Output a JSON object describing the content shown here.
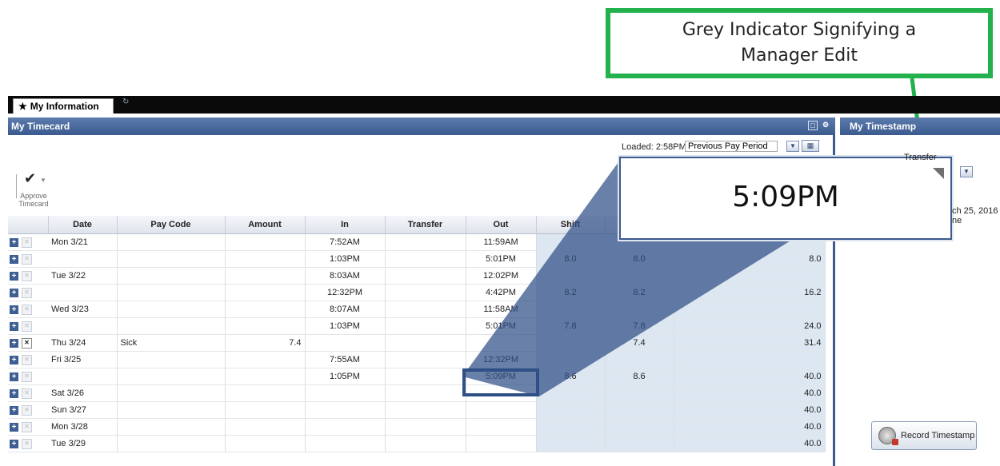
{
  "callout": {
    "line1": "Grey Indicator Signifying a",
    "line2": "Manager Edit"
  },
  "tabs": {
    "active_label": "My Information"
  },
  "left_panel": {
    "title": "My Timecard"
  },
  "right_panel": {
    "title": "My Timestamp",
    "transfer_label": "Transfer",
    "date_line1": "ch 25, 2016",
    "date_line2": "ne",
    "record_button": "Record Timestamp"
  },
  "toolbar": {
    "loaded_text": "Loaded: 2:58PM",
    "period_value": "Previous Pay Period",
    "approve_label_1": "Approve",
    "approve_label_2": "Timecard"
  },
  "zoom": {
    "value": "5:09PM"
  },
  "table": {
    "headers": [
      "Date",
      "Pay Code",
      "Amount",
      "In",
      "Transfer",
      "Out",
      "Shift",
      "",
      ""
    ],
    "rows": [
      {
        "date": "Mon 3/21",
        "paycode": "",
        "amount": "",
        "in": "7:52AM",
        "transfer": "",
        "out": "11:59AM",
        "shift": "",
        "daily": "",
        "total": "",
        "x": false
      },
      {
        "date": "",
        "paycode": "",
        "amount": "",
        "in": "1:03PM",
        "transfer": "",
        "out": "5:01PM",
        "shift": "8.0",
        "daily": "8.0",
        "total": "8.0",
        "x": false
      },
      {
        "date": "Tue 3/22",
        "paycode": "",
        "amount": "",
        "in": "8:03AM",
        "transfer": "",
        "out": "12:02PM",
        "shift": "",
        "daily": "",
        "total": "",
        "x": false
      },
      {
        "date": "",
        "paycode": "",
        "amount": "",
        "in": "12:32PM",
        "transfer": "",
        "out": "4:42PM",
        "shift": "8.2",
        "daily": "8.2",
        "total": "16.2",
        "x": false
      },
      {
        "date": "Wed 3/23",
        "paycode": "",
        "amount": "",
        "in": "8:07AM",
        "transfer": "",
        "out": "11:58AM",
        "shift": "",
        "daily": "",
        "total": "",
        "x": false
      },
      {
        "date": "",
        "paycode": "",
        "amount": "",
        "in": "1:03PM",
        "transfer": "",
        "out": "5:01PM",
        "shift": "7.8",
        "daily": "7.8",
        "total": "24.0",
        "x": false
      },
      {
        "date": "Thu 3/24",
        "paycode": "Sick",
        "amount": "7.4",
        "in": "",
        "transfer": "",
        "out": "",
        "shift": "",
        "daily": "7.4",
        "total": "31.4",
        "x": true
      },
      {
        "date": "Fri 3/25",
        "paycode": "",
        "amount": "",
        "in": "7:55AM",
        "transfer": "",
        "out": "12:32PM",
        "shift": "",
        "daily": "",
        "total": "",
        "x": false
      },
      {
        "date": "",
        "paycode": "",
        "amount": "",
        "in": "1:05PM",
        "transfer": "",
        "out": "5:09PM",
        "shift": "8.6",
        "daily": "8.6",
        "total": "40.0",
        "x": false
      },
      {
        "date": "Sat 3/26",
        "paycode": "",
        "amount": "",
        "in": "",
        "transfer": "",
        "out": "",
        "shift": "",
        "daily": "",
        "total": "40.0",
        "x": false
      },
      {
        "date": "Sun 3/27",
        "paycode": "",
        "amount": "",
        "in": "",
        "transfer": "",
        "out": "",
        "shift": "",
        "daily": "",
        "total": "40.0",
        "x": false
      },
      {
        "date": "Mon 3/28",
        "paycode": "",
        "amount": "",
        "in": "",
        "transfer": "",
        "out": "",
        "shift": "",
        "daily": "",
        "total": "40.0",
        "x": false
      },
      {
        "date": "Tue 3/29",
        "paycode": "",
        "amount": "",
        "in": "",
        "transfer": "",
        "out": "",
        "shift": "",
        "daily": "",
        "total": "40.0",
        "x": false
      }
    ]
  },
  "colors": {
    "callout_border": "#22b14c",
    "panel_header": "#3b5a8e",
    "shade": "#dde7f1"
  },
  "icons": [
    "home-icon",
    "refresh-icon",
    "checkmark-icon",
    "plus-icon",
    "delete-icon",
    "calendar-icon",
    "dropdown-icon",
    "clock-icon"
  ]
}
